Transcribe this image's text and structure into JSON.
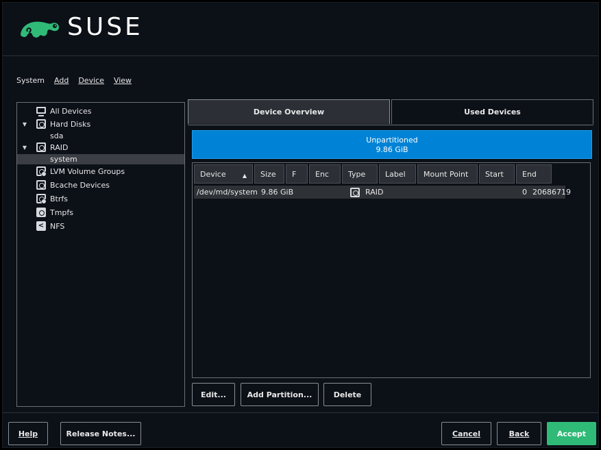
{
  "header": {
    "brand": "SUSE"
  },
  "menu": {
    "system": "System",
    "add": "Add",
    "device": "Device",
    "view": "View"
  },
  "tree": {
    "items": [
      {
        "label": "All Devices",
        "icon": "monitor-icon"
      },
      {
        "label": "Hard Disks",
        "icon": "disk-icon"
      },
      {
        "label": "sda",
        "icon": ""
      },
      {
        "label": "RAID",
        "icon": "raid-icon"
      },
      {
        "label": "system",
        "icon": ""
      },
      {
        "label": "LVM Volume Groups",
        "icon": "lvm-icon"
      },
      {
        "label": "Bcache Devices",
        "icon": "bcache-icon"
      },
      {
        "label": "Btrfs",
        "icon": "btrfs-icon"
      },
      {
        "label": "Tmpfs",
        "icon": "tmpfs-icon"
      },
      {
        "label": "NFS",
        "icon": "nfs-share-icon"
      }
    ]
  },
  "tabs": {
    "overview": "Device Overview",
    "used": "Used Devices"
  },
  "partition_bar": {
    "line1": "Unpartitioned",
    "line2": "9.86 GiB",
    "color": "#0083d6"
  },
  "table": {
    "headers": [
      "Device",
      "Size",
      "F",
      "Enc",
      "Type",
      "Label",
      "Mount Point",
      "Start",
      "End"
    ],
    "rows": [
      {
        "device": "/dev/md/system",
        "size": "9.86 GiB",
        "f": "",
        "enc": "",
        "type": "RAID",
        "label": "",
        "mount": "",
        "start": "0",
        "end": "20686719"
      }
    ]
  },
  "actions": {
    "edit": "Edit...",
    "add_partition": "Add Partition...",
    "delete": "Delete"
  },
  "footer": {
    "help": "Help",
    "release_notes": "Release Notes...",
    "cancel": "Cancel",
    "back": "Back",
    "accept": "Accept",
    "accept_color": "#30ba78"
  }
}
